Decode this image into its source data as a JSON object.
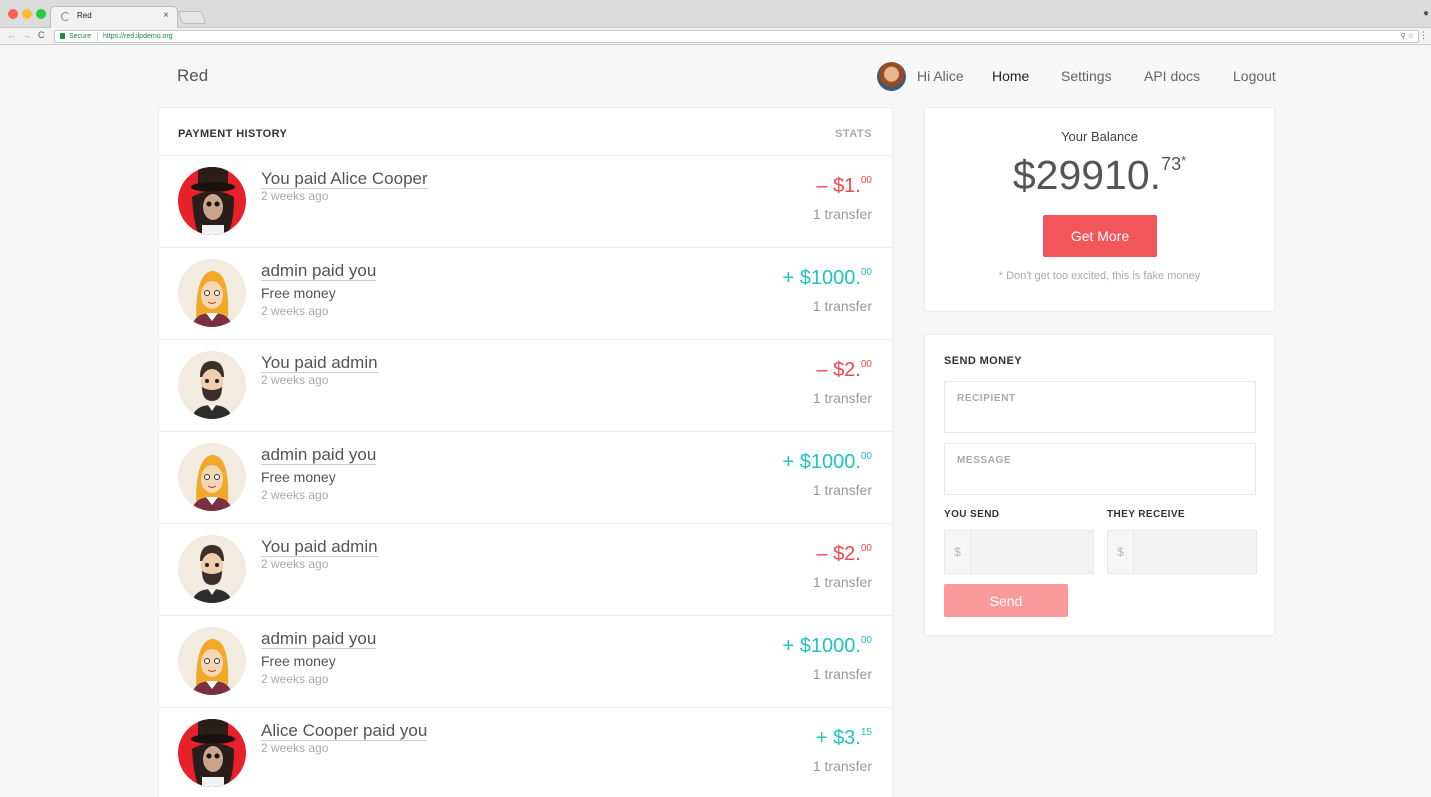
{
  "browser": {
    "tab_title": "Red",
    "tab_close": "×",
    "secure_label": "Secure",
    "url": "https://red.ilpdemo.org",
    "nav_back": "←",
    "nav_forward": "→",
    "nav_reload": "C",
    "omnibox_icons": "⚲ ☆"
  },
  "header": {
    "brand": "Red",
    "greeting": "Hi Alice",
    "nav": [
      "Home",
      "Settings",
      "API docs",
      "Logout"
    ]
  },
  "history": {
    "title": "PAYMENT HISTORY",
    "stats_label": "STATS",
    "rows": [
      {
        "avatar": "alice-cooper",
        "title": "You paid Alice Cooper",
        "message": "",
        "time": "2 weeks ago",
        "sign": "– ",
        "dollars": "$1.",
        "cents": "00",
        "direction": "negative",
        "transfers": "1 transfer"
      },
      {
        "avatar": "admin-female",
        "title": "admin paid you",
        "message": "Free money",
        "time": "2 weeks ago",
        "sign": "+ ",
        "dollars": "$1000.",
        "cents": "00",
        "direction": "positive",
        "transfers": "1 transfer"
      },
      {
        "avatar": "admin-male",
        "title": "You paid admin",
        "message": "",
        "time": "2 weeks ago",
        "sign": "– ",
        "dollars": "$2.",
        "cents": "00",
        "direction": "negative",
        "transfers": "1 transfer"
      },
      {
        "avatar": "admin-female",
        "title": "admin paid you",
        "message": "Free money",
        "time": "2 weeks ago",
        "sign": "+ ",
        "dollars": "$1000.",
        "cents": "00",
        "direction": "positive",
        "transfers": "1 transfer"
      },
      {
        "avatar": "admin-male",
        "title": "You paid admin",
        "message": "",
        "time": "2 weeks ago",
        "sign": "– ",
        "dollars": "$2.",
        "cents": "00",
        "direction": "negative",
        "transfers": "1 transfer"
      },
      {
        "avatar": "admin-female",
        "title": "admin paid you",
        "message": "Free money",
        "time": "2 weeks ago",
        "sign": "+ ",
        "dollars": "$1000.",
        "cents": "00",
        "direction": "positive",
        "transfers": "1 transfer"
      },
      {
        "avatar": "alice-cooper",
        "title": "Alice Cooper paid you",
        "message": "",
        "time": "2 weeks ago",
        "sign": "+ ",
        "dollars": "$3.",
        "cents": "15",
        "direction": "positive",
        "transfers": "1 transfer"
      }
    ]
  },
  "balance": {
    "label": "Your Balance",
    "whole": "$29910.",
    "cents": "73",
    "asterisk": "*",
    "button": "Get More",
    "note": "* Don't get too excited, this is fake money"
  },
  "send": {
    "title": "SEND MONEY",
    "recipient_label": "RECIPIENT",
    "message_label": "MESSAGE",
    "you_send_label": "YOU SEND",
    "they_receive_label": "THEY RECEIVE",
    "currency": "$",
    "button": "Send"
  },
  "colors": {
    "accent": "#f2555a",
    "negative": "#f0464e",
    "positive": "#1ec4bd",
    "send_disabled": "#fa9a9d"
  }
}
